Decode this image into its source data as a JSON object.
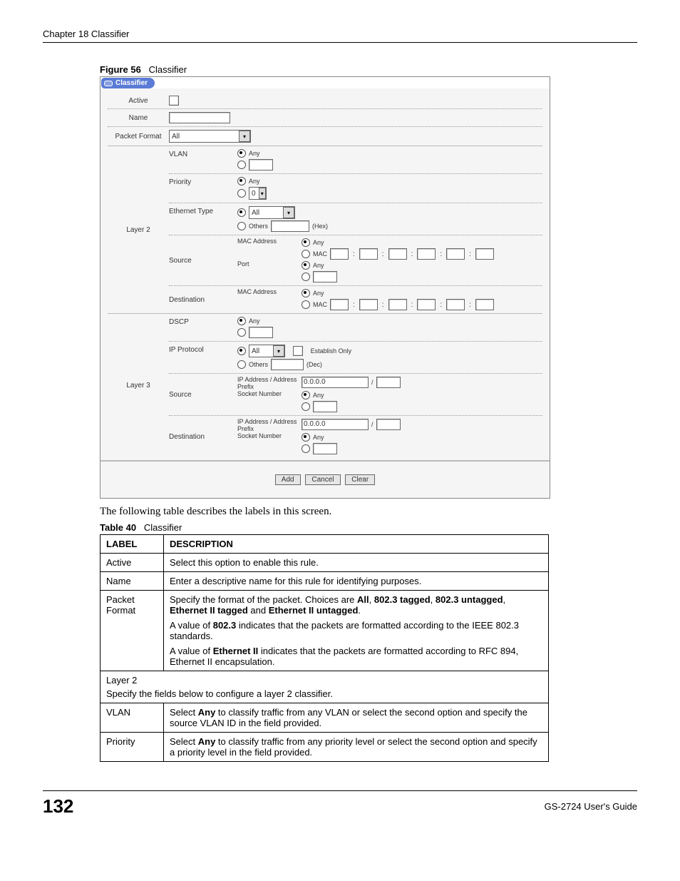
{
  "header": {
    "chapter": "Chapter 18 Classifier"
  },
  "figure": {
    "label": "Figure 56",
    "title": "Classifier"
  },
  "panel": {
    "tab": "Classifier",
    "fields": {
      "active": "Active",
      "name": "Name",
      "packet_format": "Packet Format",
      "packet_format_value": "All",
      "layer2": "Layer 2",
      "layer3": "Layer 3",
      "vlan": "VLAN",
      "priority": "Priority",
      "priority_value": "0",
      "ethernet_type": "Ethernet Type",
      "ethernet_type_value": "All",
      "others": "Others",
      "hex": "(Hex)",
      "dec": "(Dec)",
      "source": "Source",
      "destination": "Destination",
      "mac_address": "MAC Address",
      "port": "Port",
      "any": "Any",
      "mac": "MAC",
      "dscp": "DSCP",
      "ip_protocol": "IP Protocol",
      "ip_protocol_value": "All",
      "establish_only": "Establish Only",
      "ip_address_prefix": "IP Address / Address Prefix",
      "ip_default": "0.0.0.0",
      "slash": "/",
      "socket_number": "Socket Number"
    },
    "buttons": {
      "add": "Add",
      "cancel": "Cancel",
      "clear": "Clear"
    }
  },
  "intro_text": "The following table describes the labels in this screen.",
  "table": {
    "label": "Table 40",
    "title": "Classifier",
    "headers": {
      "label": "LABEL",
      "description": "DESCRIPTION"
    },
    "rows": {
      "active": {
        "label": "Active",
        "desc": "Select this option to enable this rule."
      },
      "name": {
        "label": "Name",
        "desc": "Enter a descriptive name for this rule for identifying purposes."
      },
      "packet_format": {
        "label": "Packet Format",
        "d1a": "Specify the format of the packet. Choices are ",
        "d1b": "All",
        "d1c": ", ",
        "d1d": "802.3 tagged",
        "d1e": ", ",
        "d1f": "802.3 untagged",
        "d1g": ", ",
        "d1h": "Ethernet II tagged",
        "d1i": " and ",
        "d1j": "Ethernet II untagged",
        "d1k": ".",
        "d2a": "A value of ",
        "d2b": "802.3",
        "d2c": " indicates that the packets are formatted according to the IEEE 802.3 standards.",
        "d3a": "A value of ",
        "d3b": "Ethernet II",
        "d3c": " indicates that the packets are formatted according to RFC 894, Ethernet II encapsulation."
      },
      "layer2": {
        "line1": "Layer 2",
        "line2": "Specify the fields below to configure a layer 2 classifier."
      },
      "vlan": {
        "label": "VLAN",
        "a": "Select ",
        "b": "Any",
        "c": " to classify traffic from any VLAN or select the second option and specify the source VLAN ID in the field provided."
      },
      "priority": {
        "label": "Priority",
        "a": "Select ",
        "b": "Any",
        "c": " to classify traffic from any priority level or select the second option and specify a priority level in the field provided."
      }
    }
  },
  "footer": {
    "page": "132",
    "guide": "GS-2724 User's Guide"
  }
}
